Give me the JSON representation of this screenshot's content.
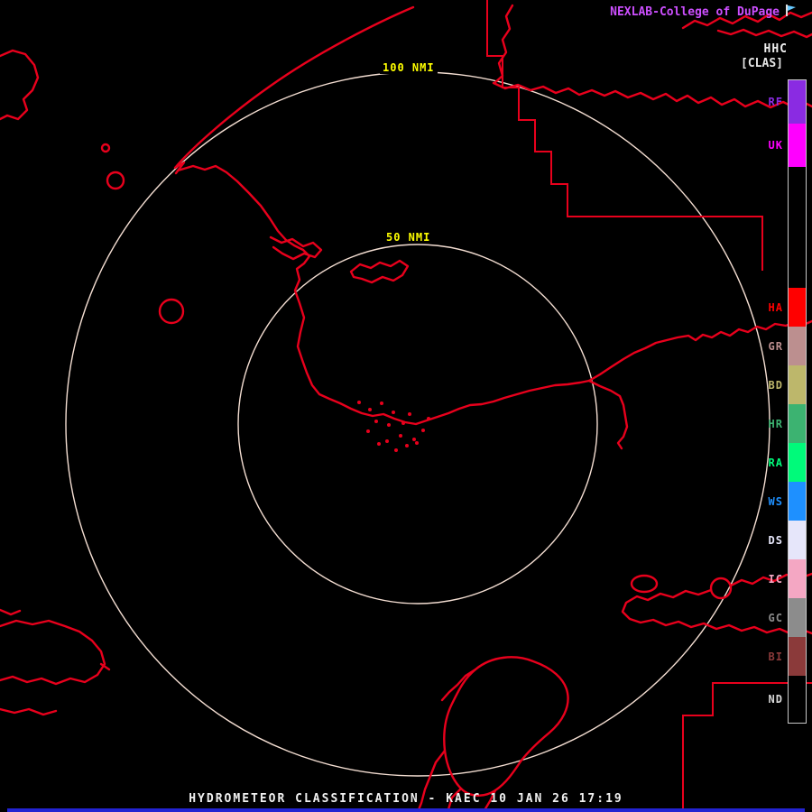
{
  "header": {
    "brand": "NEXLAB-College of DuPage",
    "product_code": "HHC",
    "product_mode": "[CLAS]"
  },
  "rings": {
    "outer_label": "100 NMI",
    "inner_label": "50 NMI"
  },
  "legend": {
    "segments": [
      {
        "code": "RF",
        "color": "#8a2be2",
        "height": 48
      },
      {
        "code": "UK",
        "color": "#ff00ff",
        "height": 48
      },
      {
        "code": "",
        "color": "#000000",
        "height": 134
      },
      {
        "code": "HA",
        "color": "#ff0000",
        "height": 43
      },
      {
        "code": "GR",
        "color": "#bc8f8f",
        "height": 43
      },
      {
        "code": "BD",
        "color": "#bdb76b",
        "height": 43
      },
      {
        "code": "HR",
        "color": "#3cb371",
        "height": 43
      },
      {
        "code": "RA",
        "color": "#00fa7a",
        "height": 43
      },
      {
        "code": "WS",
        "color": "#1e90ff",
        "height": 43
      },
      {
        "code": "DS",
        "color": "#e6e6fa",
        "height": 43
      },
      {
        "code": "IC",
        "color": "#f4a7c3",
        "height": 43
      },
      {
        "code": "GC",
        "color": "#8c8c8c",
        "height": 43
      },
      {
        "code": "BI",
        "color": "#8b3a3a",
        "height": 43
      },
      {
        "code": "ND",
        "color": "#000000",
        "height": 52,
        "label_color": "#d9d9d9"
      }
    ]
  },
  "footer": {
    "caption": "HYDROMETEOR CLASSIFICATION - KAEC 10 JAN 26 17:19"
  },
  "colors": {
    "map_red": "#e8001c",
    "ring": "#f4ded2",
    "ring_label": "#ffff00",
    "brand": "#cd4fff",
    "footer_bar": "#2323d2",
    "bar_border": "#c8c8c8"
  }
}
